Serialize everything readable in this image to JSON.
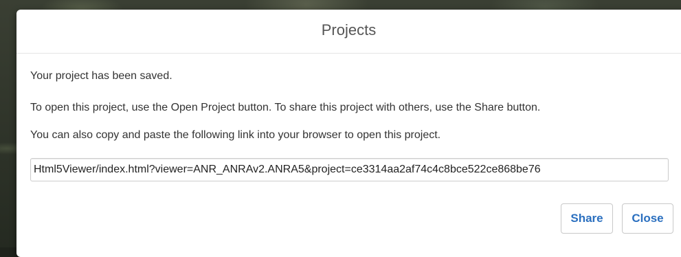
{
  "dialog": {
    "title": "Projects",
    "message_saved": "Your project has been saved.",
    "message_instructions": "To open this project, use the Open Project button. To share this project with others, use the Share button.",
    "message_copy_link": "You can also copy and paste the following link into your browser to open this project.",
    "link_value": "Html5Viewer/index.html?viewer=ANR_ANRAv2.ANRA5&project=ce3314aa2af74c4c8bce522ce868be76",
    "share_label": "Share",
    "close_label": "Close"
  },
  "colors": {
    "button_text": "#2a6fbf",
    "title_text": "#555555",
    "body_text": "#333333"
  }
}
